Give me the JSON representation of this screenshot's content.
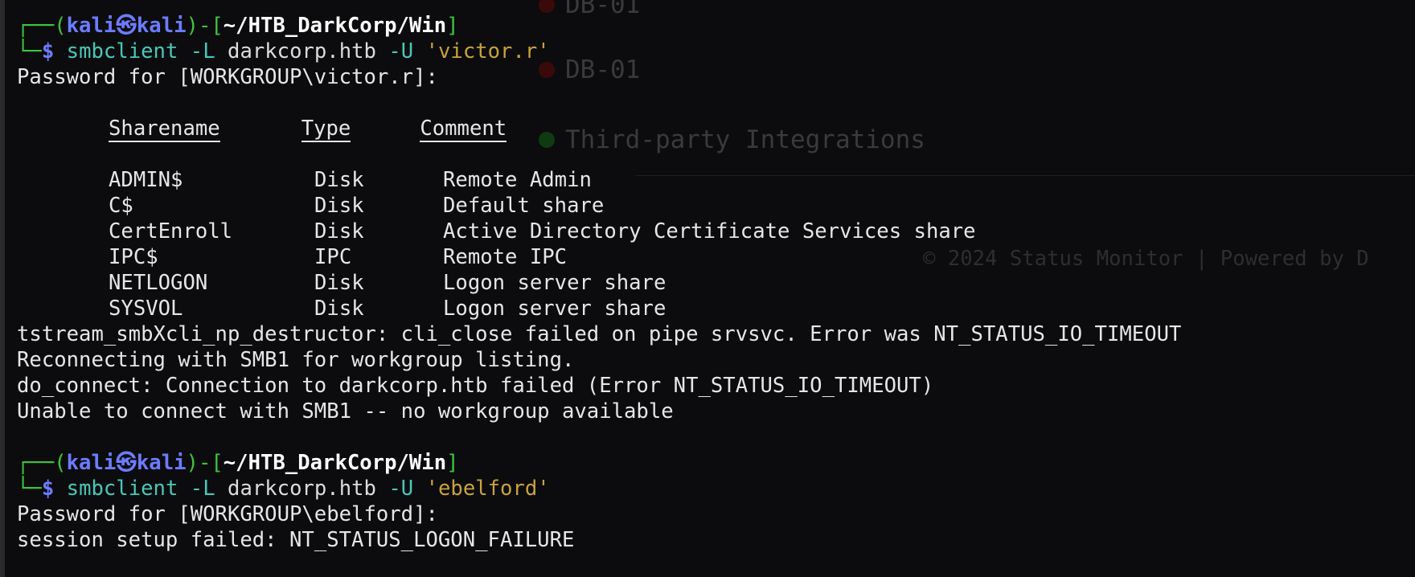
{
  "background_page": {
    "items": [
      {
        "label": "DB-01",
        "dot_color": "#3a0a0a"
      },
      {
        "label": "DB-01",
        "dot_color": "#3a0a0a"
      },
      {
        "label": "Third-party Integrations",
        "dot_color": "#0f3a12"
      }
    ],
    "footer": "© 2024 Status Monitor | Powered by D"
  },
  "prompt_1": {
    "corner": "┌──(",
    "user": "kali",
    "sep": "㉿",
    "host": "kali",
    "mid": ")-[",
    "path": "~/HTB_DarkCorp/Win",
    "close": "]",
    "corner2": "└─",
    "dollar": "$",
    "command": "smbclient",
    "flag1": "-L",
    "target": "darkcorp.htb",
    "flag2": "-U",
    "user_arg": "'victor.r'"
  },
  "password_prompt_1": "Password for [WORKGROUP\\victor.r]:",
  "shares_table": {
    "headers": [
      "Sharename",
      "Type",
      "Comment"
    ],
    "rows": [
      [
        "ADMIN$",
        "Disk",
        "Remote Admin"
      ],
      [
        "C$",
        "Disk",
        "Default share"
      ],
      [
        "CertEnroll",
        "Disk",
        "Active Directory Certificate Services share"
      ],
      [
        "IPC$",
        "IPC",
        "Remote IPC"
      ],
      [
        "NETLOGON",
        "Disk",
        "Logon server share"
      ],
      [
        "SYSVOL",
        "Disk",
        "Logon server share"
      ]
    ]
  },
  "output_lines": [
    "tstream_smbXcli_np_destructor: cli_close failed on pipe srvsvc. Error was NT_STATUS_IO_TIMEOUT",
    "Reconnecting with SMB1 for workgroup listing.",
    "do_connect: Connection to darkcorp.htb failed (Error NT_STATUS_IO_TIMEOUT)",
    "Unable to connect with SMB1 -- no workgroup available"
  ],
  "prompt_2": {
    "corner": "┌──(",
    "user": "kali",
    "sep": "㉿",
    "host": "kali",
    "mid": ")-[",
    "path": "~/HTB_DarkCorp/Win",
    "close": "]",
    "corner2": "└─",
    "dollar": "$",
    "command": "smbclient",
    "flag1": "-L",
    "target": "darkcorp.htb",
    "flag2": "-U",
    "user_arg": "'ebelford'"
  },
  "password_prompt_2": "Password for [WORKGROUP\\ebelford]:",
  "final_line": "session setup failed: NT_STATUS_LOGON_FAILURE"
}
